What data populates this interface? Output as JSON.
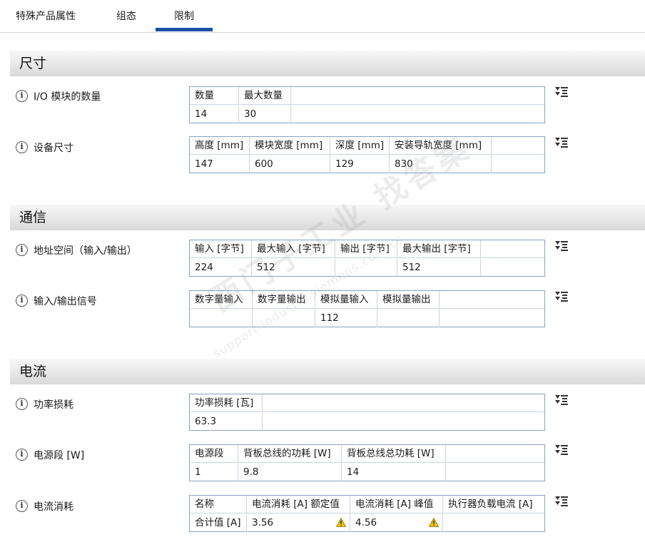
{
  "tabs": [
    {
      "label": "特殊产品属性"
    },
    {
      "label": "组态"
    },
    {
      "label": "限制"
    }
  ],
  "sections": [
    {
      "title": "尺寸"
    },
    {
      "title": "通信"
    },
    {
      "title": "电流"
    }
  ],
  "rows": [
    {
      "label": "I/O 模块的数量",
      "headers": [
        "数量",
        "最大数量",
        ""
      ],
      "values": [
        "14",
        "30",
        ""
      ]
    },
    {
      "label": "设备尺寸",
      "headers": [
        "高度 [mm]",
        "模块宽度 [mm]",
        "深度 [mm]",
        "安装导轨宽度 [mm]",
        ""
      ],
      "values": [
        "147",
        "600",
        "129",
        "830",
        ""
      ]
    },
    {
      "label": "地址空间（输入/输出）",
      "headers": [
        "输入 [字节]",
        "最大输入 [字节]",
        "输出 [字节]",
        "最大输出 [字节]",
        ""
      ],
      "values": [
        "224",
        "512",
        "",
        "512",
        ""
      ]
    },
    {
      "label": "输入/输出信号",
      "headers": [
        "数字量输入",
        "数字量输出",
        "模拟量输入",
        "模拟量输出",
        ""
      ],
      "values": [
        "",
        "",
        "112",
        "",
        ""
      ]
    },
    {
      "label": "功率损耗",
      "headers": [
        "功率损耗 [瓦]",
        ""
      ],
      "values": [
        "63.3",
        ""
      ]
    },
    {
      "label": "电源段 [W]",
      "headers": [
        "电源段",
        "背板总线的功耗 [W]",
        "背板总线总功耗 [W]",
        ""
      ],
      "values": [
        "1",
        "9.8",
        "14",
        ""
      ]
    },
    {
      "label": "电流消耗",
      "headers": [
        "名称",
        "电流消耗 [A] 额定值",
        "电流消耗 [A] 峰值",
        "执行器负载电流 [A]"
      ],
      "values": [
        "合计值 [A]",
        "3.56",
        "4.56",
        ""
      ]
    }
  ],
  "watermark": {
    "line1": "西门子工业 找答案",
    "line2": "support.industry.siemens.com/cs"
  },
  "colors": {
    "tab_active_underline": "#1c4ea8",
    "table_border": "#8aa2c2",
    "warning": "#f2c300"
  }
}
